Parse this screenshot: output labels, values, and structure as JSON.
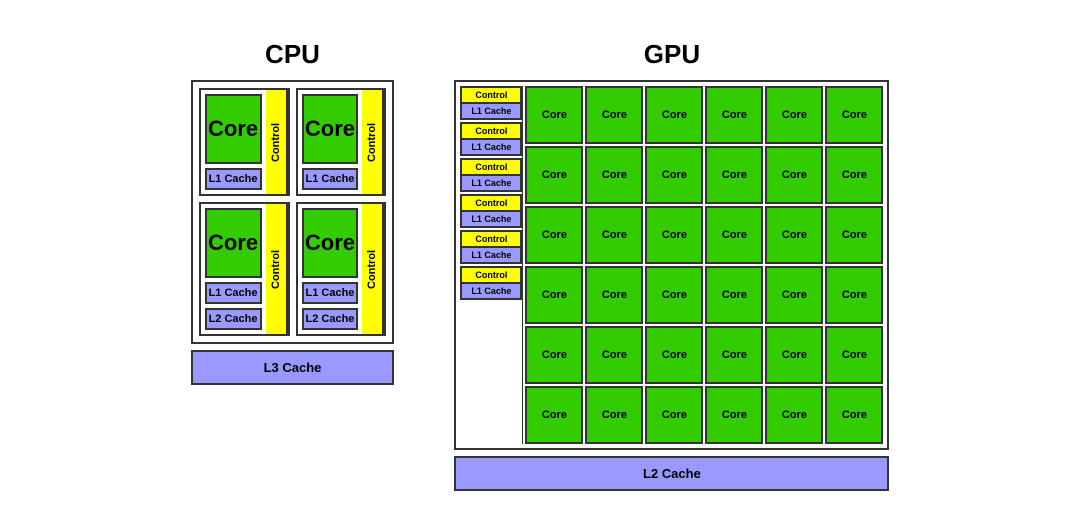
{
  "cpu": {
    "title": "CPU",
    "cores": [
      {
        "label": "Core",
        "l1": "L1 Cache",
        "l2": null,
        "control": "Control"
      },
      {
        "label": "Core",
        "l1": "L1 Cache",
        "l2": null,
        "control": "Control"
      },
      {
        "label": "Core",
        "l1": "L1 Cache",
        "l2": "L2 Cache",
        "control": "Control"
      },
      {
        "label": "Core",
        "l1": "L1 Cache",
        "l2": "L2 Cache",
        "control": "Control"
      }
    ],
    "l3": "L3 Cache"
  },
  "gpu": {
    "title": "GPU",
    "rows": 6,
    "cols": 6,
    "core_label": "Core",
    "control_label": "Control",
    "l1_label": "L1 Cache",
    "l2": "L2 Cache"
  }
}
